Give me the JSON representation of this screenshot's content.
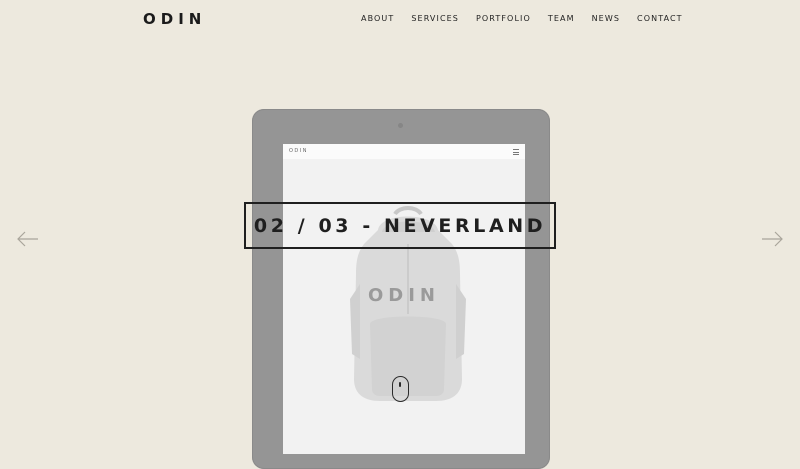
{
  "header": {
    "logo": "ODIN",
    "nav": [
      "ABOUT",
      "SERVICES",
      "PORTFOLIO",
      "TEAM",
      "NEWS",
      "CONTACT"
    ]
  },
  "slider": {
    "label": "02 / 03 - NEVERLAND",
    "prev_icon": "arrow-left-icon",
    "next_icon": "arrow-right-icon"
  },
  "device_screen": {
    "logo": "ODIN",
    "brand": "ODIN",
    "menu_icon": "hamburger-menu-icon",
    "scroll_icon": "mouse-scroll-icon"
  },
  "colors": {
    "background": "#ede9de",
    "text": "#1f1f1f",
    "tablet": "#959595"
  }
}
